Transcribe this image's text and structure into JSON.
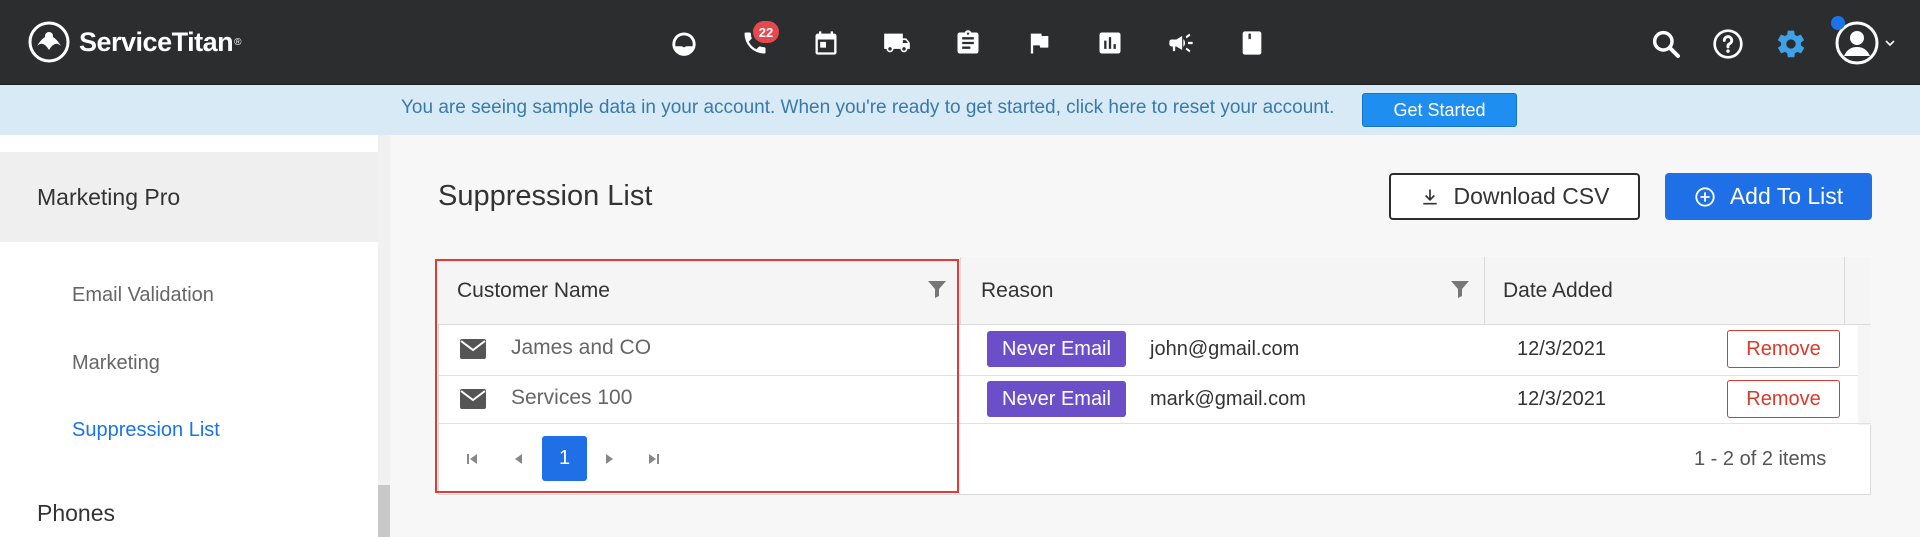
{
  "app": {
    "brand": "ServiceTitan",
    "reg": "®"
  },
  "topnav": {
    "icons": [
      "dashboard-icon",
      "phone-icon",
      "calendar-icon",
      "truck-icon",
      "clipboard-icon",
      "flag-icon",
      "reports-icon",
      "megaphone-icon",
      "book-icon"
    ],
    "phone_badge": "22",
    "right_icons": [
      "search-icon",
      "help-icon",
      "gear-icon",
      "avatar-icon"
    ]
  },
  "banner": {
    "text": "You are seeing sample data in your account. When you're ready to get started, click here to reset your account.",
    "button": "Get Started"
  },
  "sidebar": {
    "section": "Marketing Pro",
    "items": [
      {
        "label": "Email Validation",
        "active": false
      },
      {
        "label": "Marketing",
        "active": false
      },
      {
        "label": "Suppression List",
        "active": true
      }
    ],
    "next_section": "Phones"
  },
  "page": {
    "title": "Suppression List",
    "download_label": "Download CSV",
    "add_label": "Add To List"
  },
  "table": {
    "columns": [
      "Customer Name",
      "Reason",
      "Date Added"
    ],
    "rows": [
      {
        "name": "James and CO",
        "reason": "Never Email",
        "email": "john@gmail.com",
        "date": "12/3/2021",
        "action": "Remove"
      },
      {
        "name": "Services 100",
        "reason": "Never Email",
        "email": "mark@gmail.com",
        "date": "12/3/2021",
        "action": "Remove"
      }
    ],
    "pager": {
      "current_page": "1",
      "info": "1 - 2 of 2 items"
    }
  },
  "colors": {
    "topbar": "#2b2d2f",
    "primary": "#1f6fe6",
    "tag": "#6b4fc9",
    "danger": "#d93a2b",
    "banner": "#d8eaf6"
  }
}
